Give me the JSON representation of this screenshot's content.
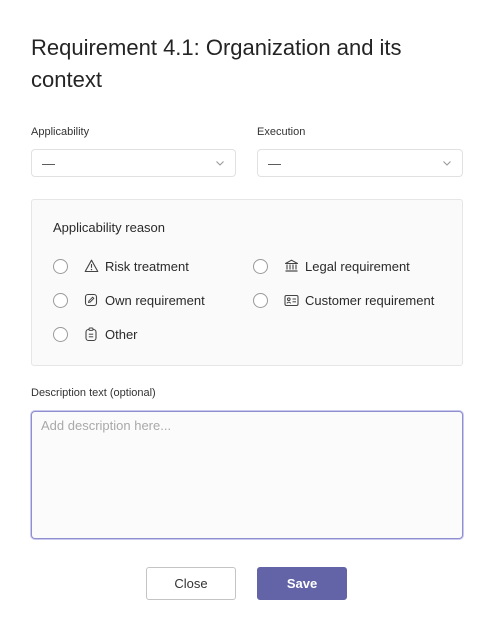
{
  "dialog": {
    "title": "Requirement 4.1: Organization and its context"
  },
  "applicability": {
    "label": "Applicability",
    "value": "—"
  },
  "execution": {
    "label": "Execution",
    "value": "—"
  },
  "reason": {
    "title": "Applicability reason",
    "options": [
      {
        "label": "Risk treatment",
        "icon": "warning-triangle-icon"
      },
      {
        "label": "Legal requirement",
        "icon": "bank-building-icon"
      },
      {
        "label": "Own requirement",
        "icon": "edit-note-icon"
      },
      {
        "label": "Customer requirement",
        "icon": "contact-card-icon"
      },
      {
        "label": "Other",
        "icon": "clipboard-list-icon"
      }
    ]
  },
  "description": {
    "label": "Description text (optional)",
    "placeholder": "Add description here...",
    "value": ""
  },
  "actions": {
    "close_label": "Close",
    "save_label": "Save"
  },
  "colors": {
    "primary": "#6264a7",
    "focus_border": "#8f8fd0"
  }
}
